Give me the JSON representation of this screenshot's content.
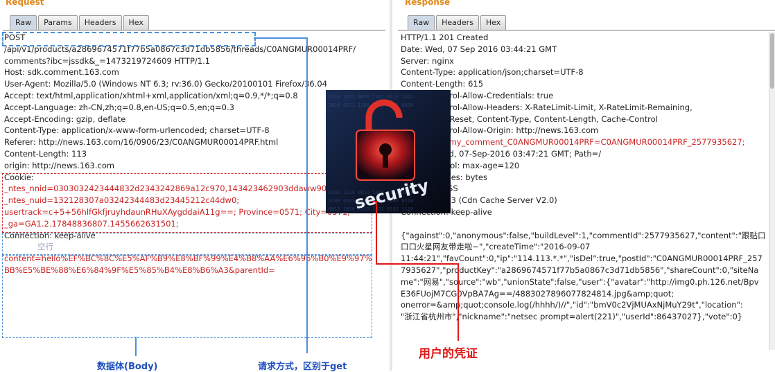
{
  "request": {
    "title": "Request",
    "tabs": [
      "Raw",
      "Params",
      "Headers",
      "Hex"
    ],
    "lines": [
      "POST",
      "/api/v1/products/a2869674571f77b5a0867c3d71db5856/threads/C0ANGMUR00014PRF/",
      "comments?ibc=jssdk&_=1473219724609 HTTP/1.1",
      "Host: sdk.comment.163.com",
      "User-Agent: Mozilla/5.0 (Windows NT 6.3; rv:36.0) Gecko/20100101 Firefox/36.04",
      "Accept: text/html,application/xhtml+xml,application/xml;q=0.9,*/*;q=0.8",
      "Accept-Language: zh-CN,zh;q=0.8,en-US;q=0.5,en;q=0.3",
      "Accept-Encoding: gzip, deflate",
      "Content-Type: application/x-www-form-urlencoded; charset=UTF-8",
      "Referer: http://news.163.com/16/0906/23/C0ANGMUR00014PRF.html",
      "Content-Length: 113",
      "origin: http://news.163.com",
      "Cookie:",
      "_ntes_nnid=0303032423444832d2343242869a12c970,143423462903ddaww9069",
      "_ntes_nuid=132128307a03242344483d23445212c44dw0;",
      "usertrack=c+5+56hlfGkfjruyhdaunRHuXAygddaiA11g==; Province=0571; City=0571;",
      "_ga=GA1.2.17848836807.1455662631501;",
      "Connection: keep-alive",
      "content=hello%EF%BC%8C%E5%AF%B9%E8%BF%99%E4%B8%AA%E6%96%B0%E9%97%",
      "BB%E5%BE%88%E6%84%9F%E5%85%B4%E8%B6%A3&parentId="
    ],
    "blank_line_label": "空行"
  },
  "response": {
    "title": "Response",
    "tabs": [
      "Raw",
      "Headers",
      "Hex"
    ],
    "lines": [
      "HTTP/1.1 201 Created",
      "Date: Wed, 07 Sep 2016 03:44:21 GMT",
      "Server: nginx",
      "Content-Type: application/json;charset=UTF-8",
      "Content-Length: 615",
      "Access-Control-Allow-Credentials: true",
      "Access-Control-Allow-Headers: X-RateLimit-Limit, X-RateLimit-Remaining,",
      "X-RateLimit-Reset, Content-Type, Content-Length, Cache-Control",
      "Access-Control-Allow-Origin: http://news.163.com",
      "Set-Cookie: my_comment_C0ANGMUR00014PRF=C0ANGMUR00014PRF_2577935627;",
      "Expires=Wed, 07-Sep-2016 03:47:21 GMT; Path=/",
      "Cache-Control: max-age=120",
      "Accept-Ranges: bytes",
      "X-Cache: MISS",
      "Via: hdx103:3 (Cdn Cache Server V2.0)",
      "Connection: keep-alive",
      "",
      "{\"against\":0,\"anonymous\":false,\"buildLevel\":1,\"commentId\":2577935627,\"content\":\"跟贴口",
      "口口火星网友带走啦~\",\"createTime\":\"2016-09-07",
      "11:44:21\",\"favCount\":0,\"ip\":\"114.113.*.*\",\"isDel\":true,\"postId\":\"C0ANGMUR00014PRF_257",
      "7935627\",\"productKey\":\"a2869674571f77b5a0867c3d71db5856\",\"shareCount\":0,\"siteNa",
      "me\":\"网易\",\"source\":\"wb\",\"unionState\":false,\"user\":{\"avatar\":\"http://img0.ph.126.net/Bpv",
      "E36FUojM7CG0VpBA7Ag==/4883027896077824814.jpg&amp;quot;",
      "onerror=&amp;quot;console.log(/hhhh/)//\",\"id\":\"bmV0c2VjMUAxNjMuY29t\",\"location\":",
      "\"浙江省杭州市\",\"nickname\":\"netsec prompt=alert(221)\",\"userId\":86437027},\"vote\":0}"
    ]
  },
  "overlay": {
    "image_text": "security",
    "icon": "padlock-icon"
  },
  "annotations": {
    "body_label": "数据体(Body)",
    "method_label": "请求方式，区别于get",
    "credential_label": "用户的凭证"
  },
  "colors": {
    "title": "#e08a1e",
    "annotation_blue": "#1f4fbf",
    "annotation_red": "#e01818"
  }
}
